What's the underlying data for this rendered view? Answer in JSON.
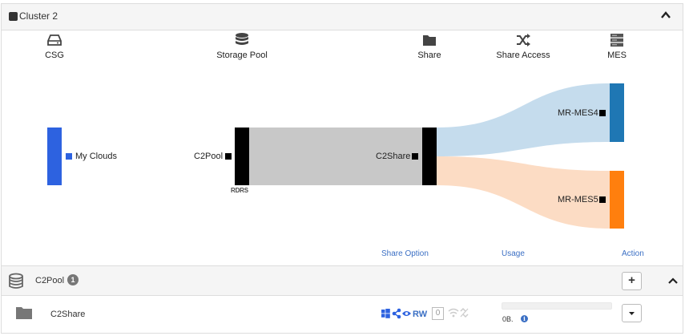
{
  "cluster": {
    "title": "Cluster 2"
  },
  "columns": [
    {
      "label": "CSG",
      "icon": "hard-drive-icon"
    },
    {
      "label": "Storage Pool",
      "icon": "database-icon"
    },
    {
      "label": "Share",
      "icon": "folder-icon"
    },
    {
      "label": "Share Access",
      "icon": "shuffle-icon"
    },
    {
      "label": "MES",
      "icon": "server-icon"
    }
  ],
  "nodes": {
    "csg": {
      "label": "My Clouds",
      "color": "#2d62e0"
    },
    "pool": {
      "label": "C2Pool",
      "color": "#000000",
      "tag": "RDRS"
    },
    "share": {
      "label": "C2Share",
      "color": "#000000"
    },
    "mes": [
      {
        "label": "MR-MES4",
        "color": "#1f77b4"
      },
      {
        "label": "MR-MES5",
        "color": "#ff7f0e"
      }
    ]
  },
  "flows": [
    {
      "from": "pool",
      "to": "share",
      "color": "#c8c8c8"
    },
    {
      "from": "share",
      "to": "MR-MES4",
      "color": "#c5dced"
    },
    {
      "from": "share",
      "to": "MR-MES5",
      "color": "#fcdcc4"
    }
  ],
  "table": {
    "headers": {
      "share_option": "Share Option",
      "usage": "Usage",
      "action": "Action"
    },
    "pool_row": {
      "name": "C2Pool",
      "badge": "1",
      "add_label": "+"
    },
    "share_row": {
      "name": "C2Share",
      "access": "RW",
      "count": "0",
      "usage_text": "0B.",
      "usage_fraction": 0.0
    }
  }
}
